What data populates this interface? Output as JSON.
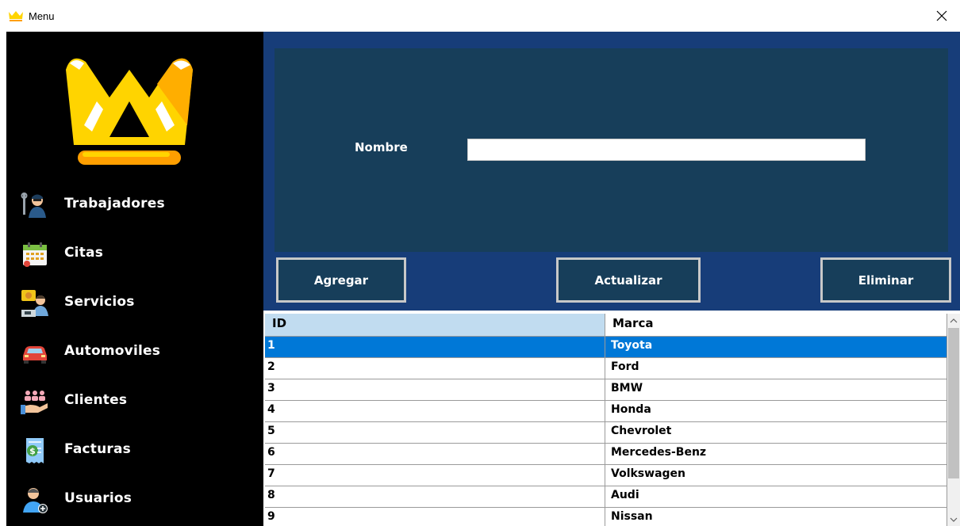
{
  "window": {
    "title": "Menu",
    "icon": "crown-icon",
    "close_icon": "close-icon"
  },
  "sidebar": {
    "logo": "crown-logo",
    "items": [
      {
        "label": "Trabajadores",
        "icon": "mechanic-worker-icon"
      },
      {
        "label": "Citas",
        "icon": "calendar-icon"
      },
      {
        "label": "Servicios",
        "icon": "service-desk-icon"
      },
      {
        "label": "Automoviles",
        "icon": "car-icon"
      },
      {
        "label": "Clientes",
        "icon": "clients-hand-icon"
      },
      {
        "label": "Facturas",
        "icon": "invoice-dollar-icon"
      },
      {
        "label": "Usuarios",
        "icon": "add-user-icon"
      }
    ]
  },
  "form": {
    "nombre_label": "Nombre",
    "nombre_value": ""
  },
  "buttons": {
    "agregar": "Agregar",
    "actualizar": "Actualizar",
    "eliminar": "Eliminar"
  },
  "table": {
    "columns": [
      "ID",
      "Marca"
    ],
    "selected_row": 0,
    "rows": [
      {
        "id": "1",
        "marca": "Toyota"
      },
      {
        "id": "2",
        "marca": "Ford"
      },
      {
        "id": "3",
        "marca": "BMW"
      },
      {
        "id": "4",
        "marca": "Honda"
      },
      {
        "id": "5",
        "marca": "Chevrolet"
      },
      {
        "id": "6",
        "marca": "Mercedes-Benz"
      },
      {
        "id": "7",
        "marca": "Volkswagen"
      },
      {
        "id": "8",
        "marca": "Audi"
      },
      {
        "id": "9",
        "marca": "Nissan"
      }
    ]
  },
  "colors": {
    "sidebar_bg": "#000000",
    "form_outer_bg": "#173d79",
    "form_inner_bg": "#173e5a",
    "selected_row": "#0078d7",
    "header_id_bg": "#c1dcf0",
    "logo_yellow": "#ffd400",
    "logo_orange": "#ff9f00"
  }
}
